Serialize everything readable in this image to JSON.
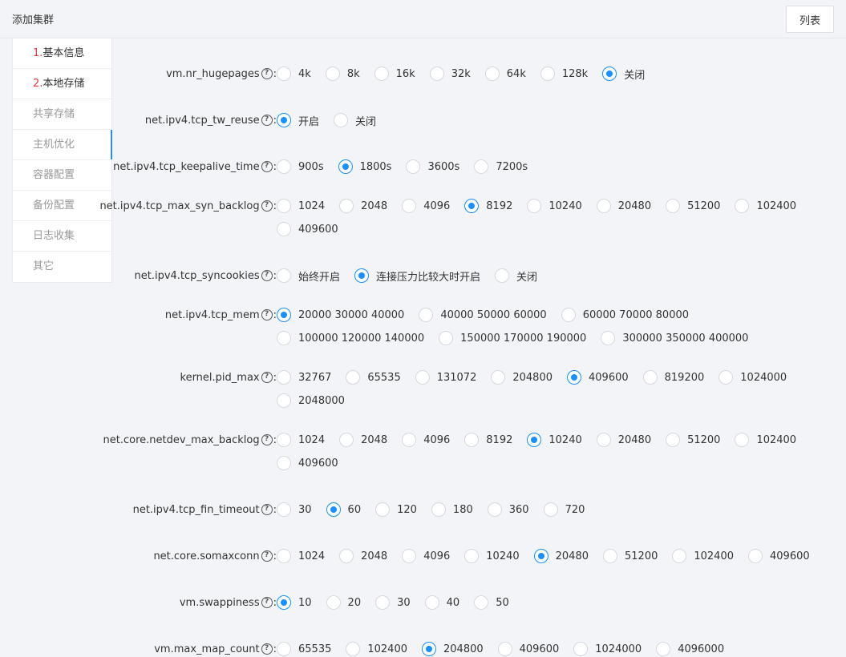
{
  "header": {
    "title": "添加集群",
    "list_button": "列表"
  },
  "steps": [
    {
      "num": "1.",
      "label": "基本信息",
      "state": "done"
    },
    {
      "num": "2.",
      "label": "本地存储",
      "state": "done"
    },
    {
      "num": "",
      "label": "共享存储",
      "state": "pending"
    },
    {
      "num": "",
      "label": "主机优化",
      "state": "active"
    },
    {
      "num": "",
      "label": "容器配置",
      "state": "pending"
    },
    {
      "num": "",
      "label": "备份配置",
      "state": "pending"
    },
    {
      "num": "",
      "label": "日志收集",
      "state": "pending"
    },
    {
      "num": "",
      "label": "其它",
      "state": "pending"
    }
  ],
  "fields": [
    {
      "label": "vm.nr_hugepages",
      "options": [
        "4k",
        "8k",
        "16k",
        "32k",
        "64k",
        "128k",
        "关闭"
      ],
      "selected": "关闭"
    },
    {
      "label": "net.ipv4.tcp_tw_reuse",
      "options": [
        "开启",
        "关闭"
      ],
      "selected": "开启"
    },
    {
      "label": "net.ipv4.tcp_keepalive_time",
      "options": [
        "900s",
        "1800s",
        "3600s",
        "7200s"
      ],
      "selected": "1800s"
    },
    {
      "label": "net.ipv4.tcp_max_syn_backlog",
      "options": [
        "1024",
        "2048",
        "4096",
        "8192",
        "10240",
        "20480",
        "51200",
        "102400",
        "409600"
      ],
      "selected": "8192"
    },
    {
      "label": "net.ipv4.tcp_syncookies",
      "options": [
        "始终开启",
        "连接压力比较大时开启",
        "关闭"
      ],
      "selected": "连接压力比较大时开启"
    },
    {
      "label": "net.ipv4.tcp_mem",
      "options": [
        "20000 30000 40000",
        "40000 50000 60000",
        "60000 70000 80000",
        "100000 120000 140000",
        "150000 170000 190000",
        "300000 350000 400000"
      ],
      "selected": "20000 30000 40000"
    },
    {
      "label": "kernel.pid_max",
      "options": [
        "32767",
        "65535",
        "131072",
        "204800",
        "409600",
        "819200",
        "1024000",
        "2048000"
      ],
      "selected": "409600"
    },
    {
      "label": "net.core.netdev_max_backlog",
      "options": [
        "1024",
        "2048",
        "4096",
        "8192",
        "10240",
        "20480",
        "51200",
        "102400",
        "409600"
      ],
      "selected": "10240"
    },
    {
      "label": "net.ipv4.tcp_fin_timeout",
      "options": [
        "30",
        "60",
        "120",
        "180",
        "360",
        "720"
      ],
      "selected": "60"
    },
    {
      "label": "net.core.somaxconn",
      "options": [
        "1024",
        "2048",
        "4096",
        "10240",
        "20480",
        "51200",
        "102400",
        "409600"
      ],
      "selected": "20480"
    },
    {
      "label": "vm.swappiness",
      "options": [
        "10",
        "20",
        "30",
        "40",
        "50"
      ],
      "selected": "10"
    },
    {
      "label": "vm.max_map_count",
      "options": [
        "65535",
        "102400",
        "204800",
        "409600",
        "1024000",
        "4096000"
      ],
      "selected": "204800"
    }
  ],
  "colors": {
    "accent": "#1890ff",
    "step_number": "#e4393c"
  }
}
